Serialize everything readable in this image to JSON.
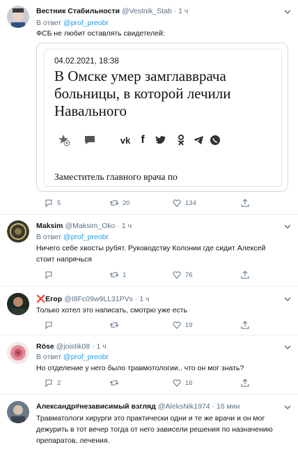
{
  "tweets": [
    {
      "name": "Вестник Стабильности",
      "handle": "@Vestnik_Stab",
      "time": "· 1 ч",
      "reply_prefix": "В ответ",
      "reply_to": "@prof_preobr",
      "text": "ФСБ не любит оставлять свидетелей:",
      "counts": {
        "reply": "5",
        "retweet": "20",
        "like": "134"
      }
    },
    {
      "name": "Maksim",
      "handle": "@Maksim_Oko · 1 ч",
      "reply_prefix": "В ответ",
      "reply_to": "@prof_preobr",
      "text": "Ничего себе хвосты рубят. Руководству Колонии где сидит Алексей стоит напрячься",
      "counts": {
        "reply": "",
        "retweet": "1",
        "like": "76"
      }
    },
    {
      "name": "❌Егор",
      "handle": "@I8Fc09w9LL31PVs · 1 ч",
      "text": "Только хотел это написать, смотрю уже есть",
      "counts": {
        "reply": "",
        "retweet": "",
        "like": "19"
      }
    },
    {
      "name": "Röse",
      "handle": "@joistik08 · 1 ч",
      "reply_prefix": "В ответ",
      "reply_to": "@prof_preobr",
      "text": "Но отделение у него было травмотологии.. что он мог знать?",
      "counts": {
        "reply": "2",
        "retweet": "",
        "like": "16"
      }
    },
    {
      "name": "Александр#независимый взгляд",
      "handle": "@AleksNik1974 · 16 мин",
      "text": "Травматологи хирурги это практически одни и те же врачи и он мог дежурить в тот вечер тогда от него зависели решения по назначению препаратов, лечения.",
      "counts": {}
    }
  ],
  "card": {
    "date": "04.02.2021, 18:38",
    "title": "В Омске умер замглавврача больницы, в которой лечили Навального",
    "subtitle": "Заместитель главного врача по"
  },
  "icons": {
    "reply": "reply-icon",
    "retweet": "retweet-icon",
    "like": "like-icon",
    "share": "share-icon",
    "more": "more-icon"
  },
  "colors": {
    "text": "#0f1419",
    "secondary": "#5b7083",
    "link": "#1d9bf0",
    "border": "#ebeef0",
    "error_red": "#e0245e"
  }
}
